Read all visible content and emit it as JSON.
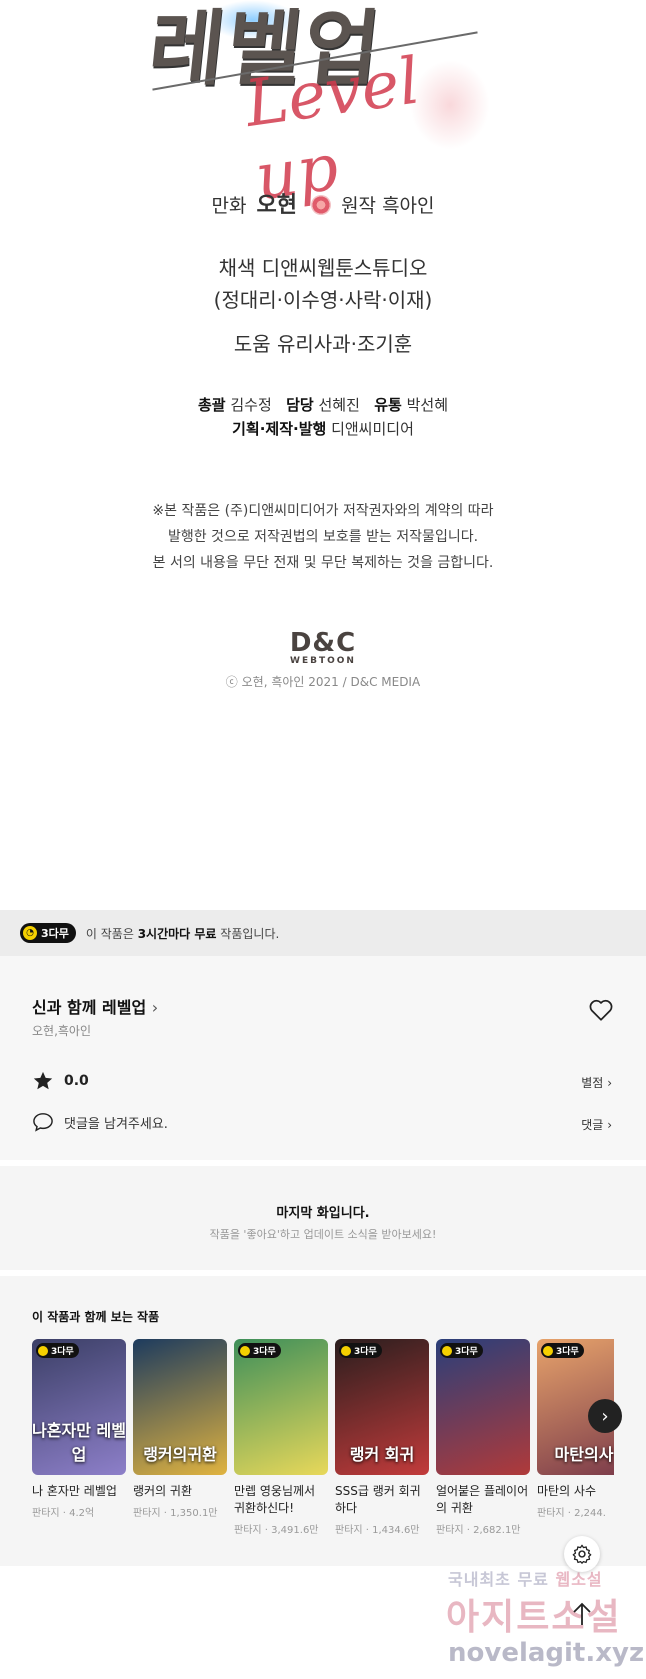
{
  "credits": {
    "logo_kr": "레벨업",
    "logo_en": "Level up",
    "line1_role1": "만화",
    "line1_name1": "오현",
    "line1_role2": "원작",
    "line1_name2": "흑아인",
    "color_line": "채색 디앤씨웹툰스튜디오",
    "color_members": "(정대리·이수영·사락·이재)",
    "help_line": "도움 유리사과·조기훈",
    "staff": {
      "director_label": "총괄",
      "director": "김수정",
      "manager_label": "담당",
      "manager": "선혜진",
      "dist_label": "유통",
      "dist": "박선혜",
      "publish_label": "기획·제작·발행",
      "publisher": "디앤씨미디어"
    },
    "notice1": "※본 작품은 (주)디앤씨미디어가 저작권자와의 계약의 따라",
    "notice2": "발행한 것으로 저작권법의 보호를 받는 저작물입니다.",
    "notice3": "본 서의 내용을 무단 전재 및 무단 복제하는 것을 금합니다.",
    "dc_logo": "D&C",
    "dc_sub": "WEBTOON",
    "copyright": "ⓒ 오현, 흑아인 2021 / D&C MEDIA"
  },
  "free_bar": {
    "badge": "3다무",
    "text_pre": "이 작품은 ",
    "text_bold": "3시간마다 무료",
    "text_post": " 작품입니다."
  },
  "work": {
    "title": "신과 함께 레벨업",
    "authors": "오현,흑아인",
    "rating": "0.0",
    "rating_link": "별점",
    "comment_prompt": "댓글을 남겨주세요.",
    "comment_link": "댓글"
  },
  "last": {
    "title": "마지막 화입니다.",
    "subtitle": "작품을 '좋아요'하고 업데이트 소식을 받아보세요!"
  },
  "recommendations": {
    "title": "이 작품과 함께 보는 작품",
    "items": [
      {
        "name": "나 혼자만 레벨업",
        "meta": "판타지 · 4.2억",
        "badge": "3다무",
        "art": "나혼자만 레벨업",
        "color1": "#3b3f66",
        "color2": "#8d7fc9"
      },
      {
        "name": "랭커의 귀환",
        "meta": "판타지 · 1,350.1만",
        "badge": "",
        "art": "랭커의귀환",
        "color1": "#1d3b5e",
        "color2": "#e0b340"
      },
      {
        "name": "만렙 영웅님께서 귀환하신다!",
        "meta": "판타지 · 3,491.6만",
        "badge": "3다무",
        "art": "",
        "color1": "#3e8f5a",
        "color2": "#e8d85a"
      },
      {
        "name": "SSS급 랭커 회귀하다",
        "meta": "판타지 · 1,434.6만",
        "badge": "3다무",
        "art": "랭커 회귀",
        "color1": "#2a1e1e",
        "color2": "#c23b3b"
      },
      {
        "name": "얼어붙은 플레이어의 귀환",
        "meta": "판타지 · 2,682.1만",
        "badge": "3다무",
        "art": "",
        "color1": "#2a3f7a",
        "color2": "#b03a3a"
      },
      {
        "name": "마탄의 사수",
        "meta": "판타지 · 2,244.",
        "badge": "3다무",
        "art": "마탄의사",
        "color1": "#e7a36b",
        "color2": "#7a3a4a"
      }
    ]
  },
  "watermark": {
    "line1a": "국내최초 무료",
    "line1b": "웹소설",
    "line2": "아지트소설",
    "line3": "novelagit.xyz"
  },
  "icons": {
    "heart": "heart-icon",
    "star": "star-icon",
    "comment": "comment-icon",
    "chevron": "chevron-right-icon",
    "gear": "gear-icon",
    "up": "arrow-up-icon"
  }
}
